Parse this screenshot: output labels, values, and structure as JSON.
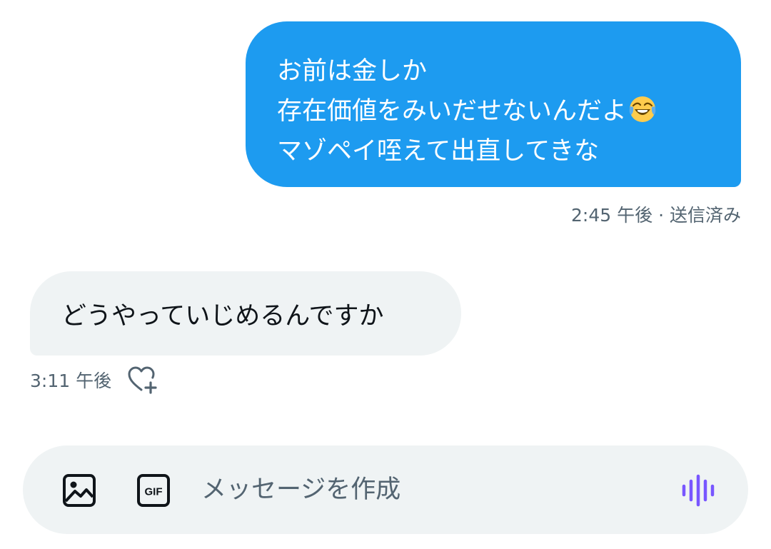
{
  "sent_message": {
    "lines": [
      "お前は金しか",
      "存在価値をみいだせないんだよ",
      "マゾペイ咥えて出直してきな"
    ],
    "emoji": "face-with-tears-of-joy",
    "timestamp": "2:45 午後",
    "separator": "·",
    "status": "送信済み"
  },
  "received_message": {
    "text": "どうやっていじめるんですか",
    "timestamp": "3:11 午後"
  },
  "composer": {
    "placeholder": "メッセージを作成",
    "gif_label": "GIF",
    "icons": [
      "image-icon",
      "gif-icon",
      "voice-waveform-icon"
    ]
  },
  "colors": {
    "sent_bubble": "#1d9bf0",
    "received_bubble": "#eff3f4",
    "meta_text": "#536471",
    "voice_accent": "#7856ff"
  }
}
